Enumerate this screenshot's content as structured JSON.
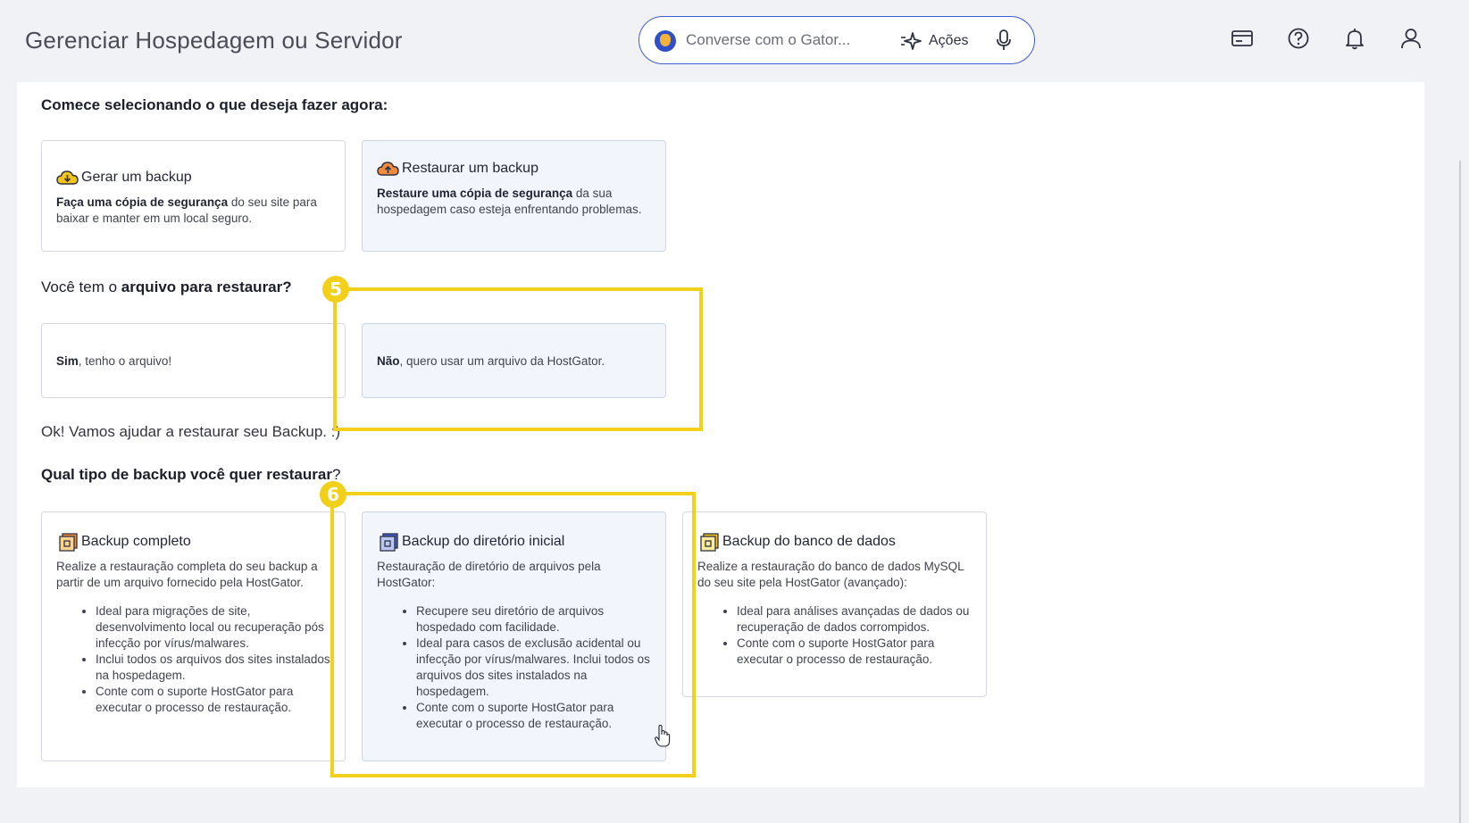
{
  "header": {
    "title": "Gerenciar Hospedagem ou Servidor",
    "search": {
      "placeholder": "Converse com o Gator...",
      "value": ""
    },
    "actions_label": "Ações",
    "icons": [
      "billing-card-icon",
      "help-icon",
      "notification-bell-icon",
      "user-profile-icon"
    ]
  },
  "sections": {
    "start": {
      "heading": "Comece selecionando o que deseja fazer agora:",
      "cards": [
        {
          "title": "Gerar um backup",
          "desc_bold": "Faça uma cópia de segurança",
          "desc_rest": " do seu site para baixar e manter em um local seguro."
        },
        {
          "title": "Restaurar um backup",
          "desc_bold": "Restaure uma cópia de segurança",
          "desc_rest": " da sua hospedagem caso esteja enfrentando problemas."
        }
      ]
    },
    "file": {
      "heading_prefix": "Você tem o ",
      "heading_bold": "arquivo para restaurar?",
      "options": [
        {
          "bold": "Sim",
          "rest": ", tenho o arquivo!"
        },
        {
          "bold": "Não",
          "rest": ", quero usar um arquivo da HostGator."
        }
      ]
    },
    "message": "Ok! Vamos ajudar a restaurar seu Backup. :)",
    "type": {
      "heading_bold": "Qual tipo de backup você quer restaurar",
      "heading_suffix": "?",
      "cards": [
        {
          "title": "Backup completo",
          "desc": "Realize a restauração completa do seu backup a partir de um arquivo fornecido pela HostGator.",
          "items": [
            "Ideal para migrações de site, desenvolvimento local ou recuperação pós infecção por vírus/malwares.",
            "Inclui todos os arquivos dos sites instalados na hospedagem.",
            "Conte com o suporte HostGator para executar o processo de restauração."
          ]
        },
        {
          "title": "Backup do diretório inicial",
          "desc": "Restauração de diretório de arquivos pela HostGator:",
          "items": [
            "Recupere seu diretório de arquivos hospedado com facilidade.",
            "Ideal para casos de exclusão acidental ou infecção por vírus/malwares. Inclui todos os arquivos dos sites instalados na hospedagem.",
            "Conte com o suporte HostGator para executar o processo de restauração."
          ]
        },
        {
          "title": "Backup do banco de dados",
          "desc": "Realize a restauração do banco de dados MySQL do seu site pela HostGator (avançado):",
          "items": [
            "Ideal para análises avançadas de dados ou recuperação de dados corrompidos.",
            "Conte com o suporte HostGator para executar o processo de restauração."
          ]
        }
      ]
    }
  },
  "annotations": {
    "step5": "5",
    "step6": "6"
  },
  "colors": {
    "accent": "#3f5cd6",
    "highlight": "#f2d01b",
    "selected_card": "#f2f6fc"
  }
}
